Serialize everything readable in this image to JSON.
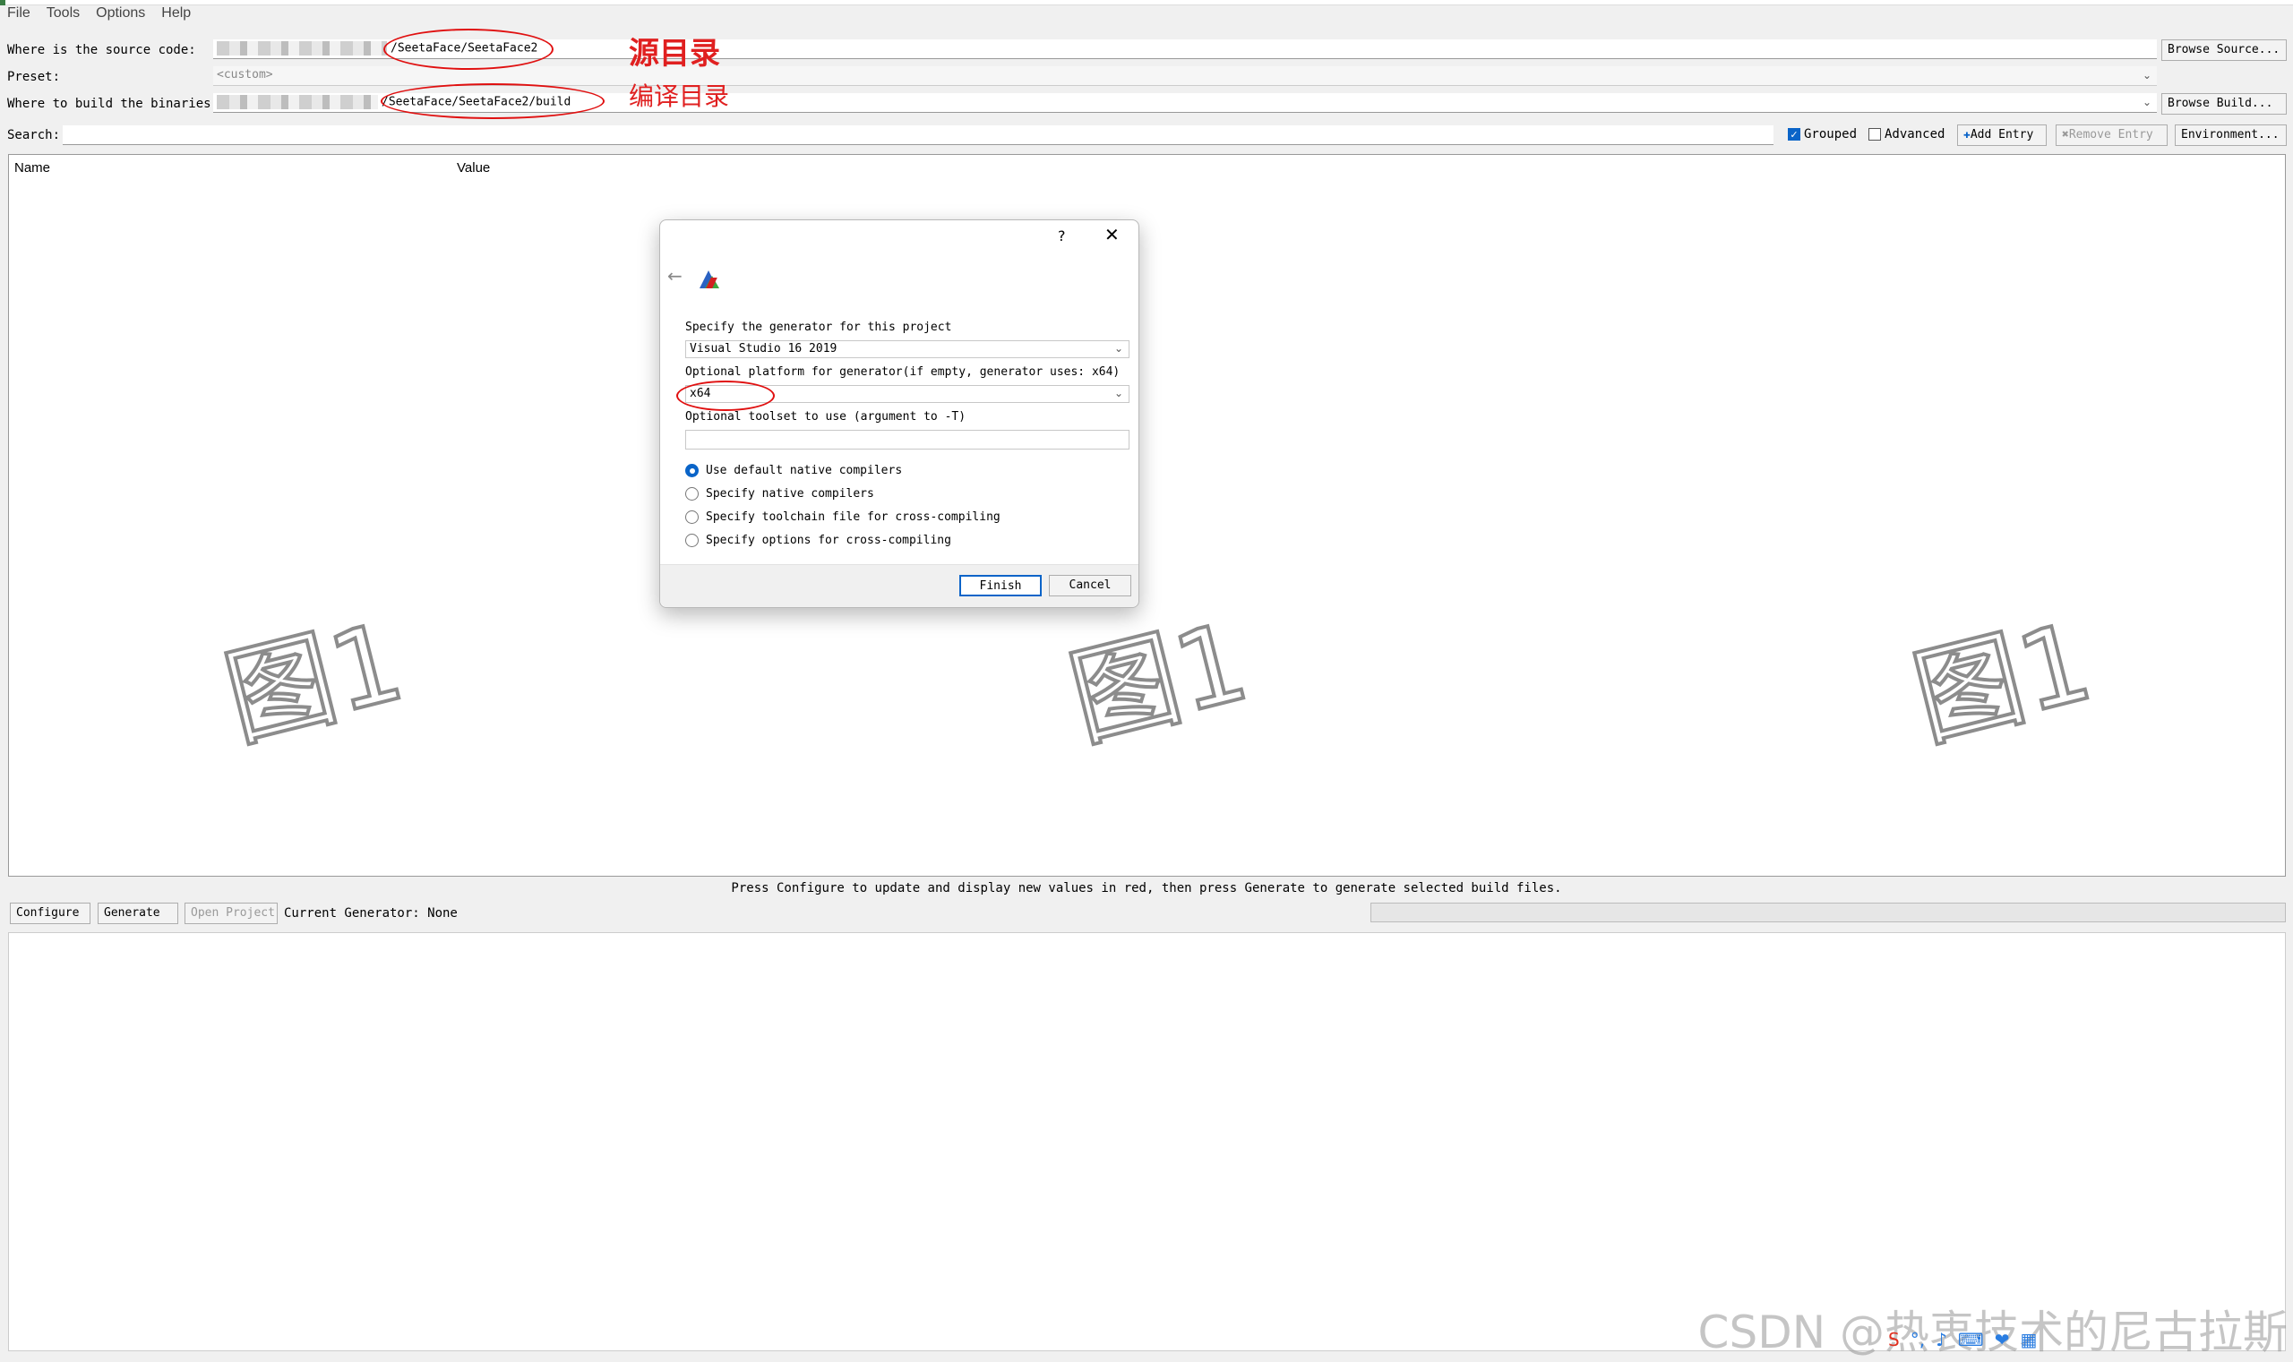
{
  "menu": [
    "File",
    "Tools",
    "Options",
    "Help"
  ],
  "source": {
    "label": "Where is the source code:",
    "value": "/SeetaFace/SeetaFace2",
    "browse": "Browse Source..."
  },
  "preset": {
    "label": "Preset:",
    "value": "<custom>"
  },
  "build": {
    "label": "Where to build the binaries:",
    "value": "/SeetaFace/SeetaFace2/build",
    "browse": "Browse Build..."
  },
  "annotations": {
    "source_dir": "源目录",
    "build_dir": "编译目录",
    "color": "#e02020"
  },
  "search": {
    "label": "Search:",
    "value": ""
  },
  "toolbar": {
    "grouped": "Grouped",
    "grouped_checked": true,
    "advanced": "Advanced",
    "advanced_checked": false,
    "add_entry": "Add Entry",
    "remove_entry": "Remove Entry",
    "environment": "Environment..."
  },
  "table": {
    "columns": [
      "Name",
      "Value"
    ]
  },
  "watermark": "图1",
  "status_message": "Press Configure to update and display new values in red, then press Generate to generate selected build files.",
  "actions": {
    "configure": "Configure",
    "generate": "Generate",
    "open_project": "Open Project",
    "current_generator": "Current Generator: None"
  },
  "dialog": {
    "help": "?",
    "close": "✕",
    "generator_label": "Specify the generator for this project",
    "generator_value": "Visual Studio 16 2019",
    "platform_label": "Optional platform for generator(if empty, generator uses: x64)",
    "platform_value": "x64",
    "toolset_label": "Optional toolset to use (argument to -T)",
    "toolset_value": "",
    "compiler_options": [
      "Use default native compilers",
      "Specify native compilers",
      "Specify toolchain file for cross-compiling",
      "Specify options for cross-compiling"
    ],
    "selected_option": 0,
    "finish": "Finish",
    "cancel": "Cancel"
  },
  "footer_watermark": "CSDN @热衷技术的尼古拉斯",
  "tray_icons": [
    "sogou-icon",
    "punctuation-icon",
    "microphone-icon",
    "keyboard-icon",
    "skin-icon",
    "toolbox-icon"
  ]
}
